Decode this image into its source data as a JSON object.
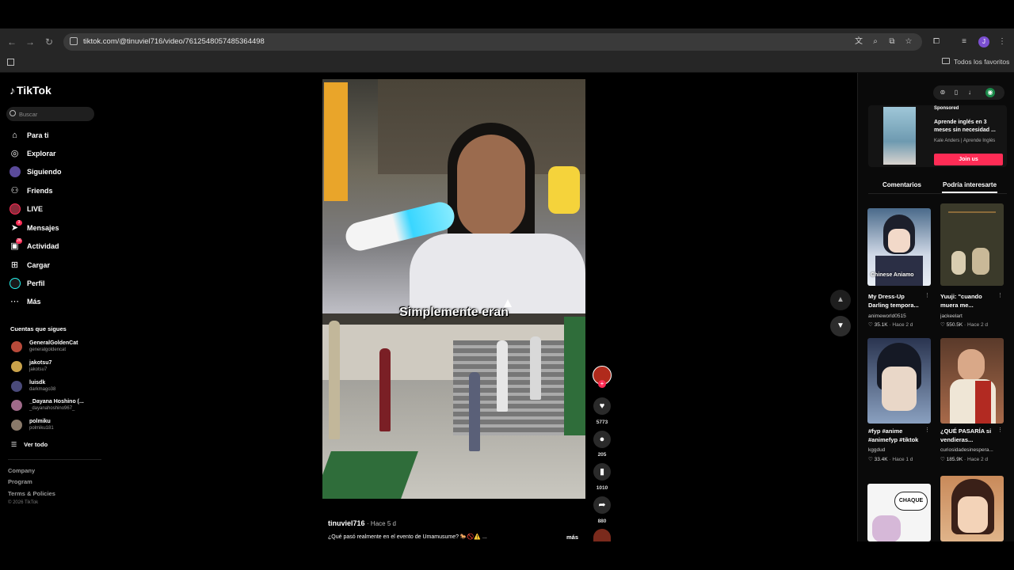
{
  "browser": {
    "url": "tiktok.com/@tinuviel716/video/7612548057485364498",
    "avatar_letter": "J",
    "bookmarks_label": "Todos los favoritos"
  },
  "tiktok": {
    "logo": "TikTok",
    "search_placeholder": "Buscar",
    "nav": [
      {
        "label": "Para ti",
        "icon": "home-icon"
      },
      {
        "label": "Explorar",
        "icon": "compass-icon"
      },
      {
        "label": "Siguiendo",
        "icon": "following-avatar-icon"
      },
      {
        "label": "Friends",
        "icon": "friends-icon"
      },
      {
        "label": "LIVE",
        "icon": "live-avatar-icon"
      },
      {
        "label": "Mensajes",
        "icon": "paper-plane-icon",
        "badge": "3"
      },
      {
        "label": "Actividad",
        "icon": "inbox-icon",
        "badge": "26"
      },
      {
        "label": "Cargar",
        "icon": "upload-icon"
      },
      {
        "label": "Perfil",
        "icon": "profile-icon"
      },
      {
        "label": "Más",
        "icon": "more-dots-icon"
      }
    ],
    "following_title": "Cuentas que sigues",
    "following": [
      {
        "name": "GeneralGoldenCat",
        "user": "generalgoldencat",
        "color": "#b84a3a"
      },
      {
        "name": "jakotsu7",
        "user": "jakotsu7",
        "color": "#c9a24a"
      },
      {
        "name": "luisdk",
        "user": "darkmago38",
        "color": "#4a4a7a"
      },
      {
        "name": "_Dayana Hoshino (...",
        "user": "_dayanahoshino967_",
        "color": "#a06a8a"
      },
      {
        "name": "polmiku",
        "user": "polmiku181",
        "color": "#8a7a6a"
      }
    ],
    "see_all": "Ver todo",
    "footer": [
      "Company",
      "Program",
      "Terms & Policies"
    ],
    "copyright": "© 2026 TikTok"
  },
  "video": {
    "caption": "Simplemente eran",
    "author": "tinuviel716",
    "time": "· Hace 5 d",
    "description": "¿Qué pasó realmente en el evento de Umamusume? 🐎🚫⚠️ ...",
    "more": "más",
    "likes": "5773",
    "comments": "205",
    "saves": "1010",
    "shares": "880"
  },
  "right": {
    "ad": {
      "sponsored": "Sponsored",
      "title": "Aprende inglés en 3 meses sin necesidad ...",
      "sub": "Kale Anders | Aprende Inglés",
      "cta": "Join us"
    },
    "tabs": [
      "Comentarios",
      "Podría interesarte"
    ],
    "cards": [
      {
        "title": "My Dress-Up Darling tempora...",
        "user": "animeworld0515",
        "likes": "♡ 35.1K",
        "time": "· Hace 2 d"
      },
      {
        "title": "Yuuji: \"cuando muera me...",
        "user": "jackeelart",
        "likes": "♡ 550.5K",
        "time": "· Hace 2 d"
      },
      {
        "title": "#fyp #anime #animefyp #tiktok",
        "user": "kggdud",
        "likes": "♡ 33.4K",
        "time": "· Hace 1 d"
      },
      {
        "title": "¿QUÉ PASARÍA si vendieras...",
        "user": "curiosidadesinespera...",
        "likes": "♡ 185.9K",
        "time": "· Hace 2 d"
      },
      {
        "title": "",
        "user": "",
        "likes": "",
        "time": ""
      },
      {
        "title": "",
        "user": "",
        "likes": "",
        "time": ""
      }
    ],
    "card1_overlay": "Chinese Aniamo",
    "card5_bubble": "CHAQUE"
  }
}
